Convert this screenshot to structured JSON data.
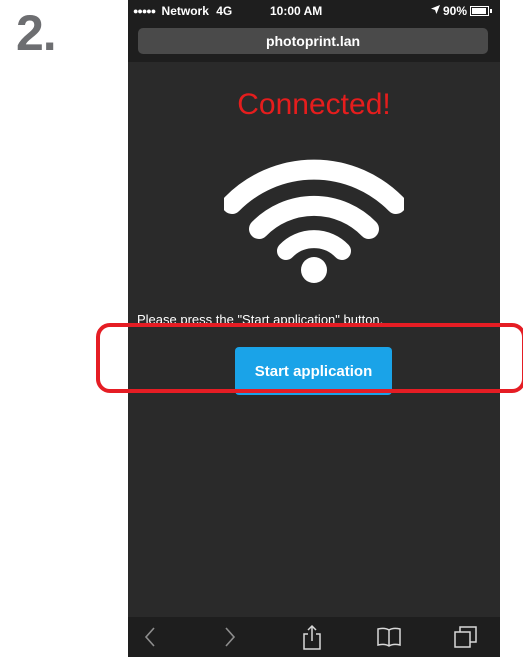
{
  "step": {
    "number": "2."
  },
  "status_bar": {
    "signal_dots": "●●●●●",
    "carrier": "Network",
    "network_type": "4G",
    "time": "10:00 AM",
    "battery_percent": "90%",
    "battery_level": 0.9
  },
  "browser": {
    "url": "photoprint.lan"
  },
  "page": {
    "title": "Connected!",
    "instructions": "Please press the \"Start application\" button.",
    "start_button_label": "Start application"
  },
  "icons": {
    "wifi": "wifi-icon",
    "back": "back-chevron-icon",
    "forward": "forward-chevron-icon",
    "share": "share-icon",
    "bookmarks": "bookmarks-icon",
    "tabs": "tabs-icon"
  },
  "colors": {
    "title_red": "#e51d1d",
    "button_blue": "#1aa3e8",
    "highlight_red": "#e51d24",
    "step_gray": "#6d6e71"
  }
}
